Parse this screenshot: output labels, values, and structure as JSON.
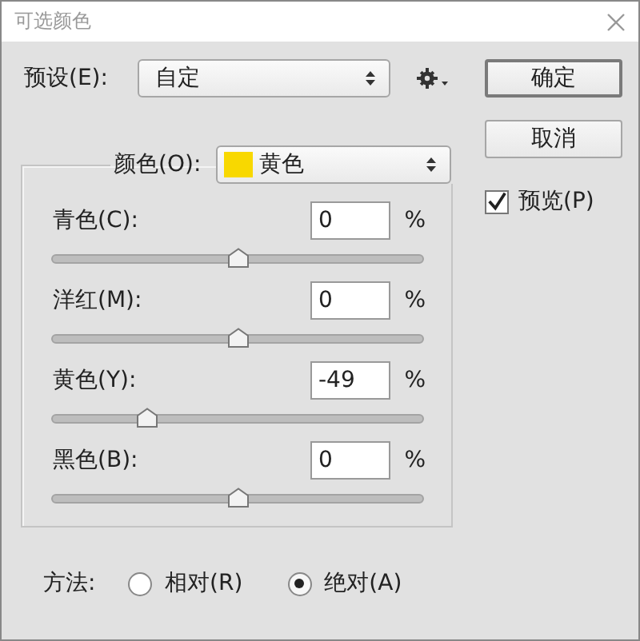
{
  "window": {
    "title": "可选颜色"
  },
  "preset": {
    "label": "预设(E):",
    "value": "自定"
  },
  "buttons": [
    {
      "label": "确定",
      "default": true
    },
    {
      "label": "取消",
      "default": false
    }
  ],
  "preview": {
    "label": "预览(P)",
    "checked": true
  },
  "color_select": {
    "label": "颜色(O):",
    "value": "黄色",
    "color": "#f8d800"
  },
  "sliders": [
    {
      "label": "青色(C):",
      "value": "0",
      "unit": "%",
      "level": 0.5
    },
    {
      "label": "洋红(M):",
      "value": "0",
      "unit": "%",
      "level": 0.5
    },
    {
      "label": "黄色(Y):",
      "value": "-49",
      "unit": "%",
      "level": 0.255
    },
    {
      "label": "黑色(B):",
      "value": "0",
      "unit": "%",
      "level": 0.5
    }
  ],
  "method": {
    "label": "方法:",
    "options": [
      {
        "label": "相对(R)",
        "selected": false
      },
      {
        "label": "绝对(A)",
        "selected": true
      }
    ]
  }
}
